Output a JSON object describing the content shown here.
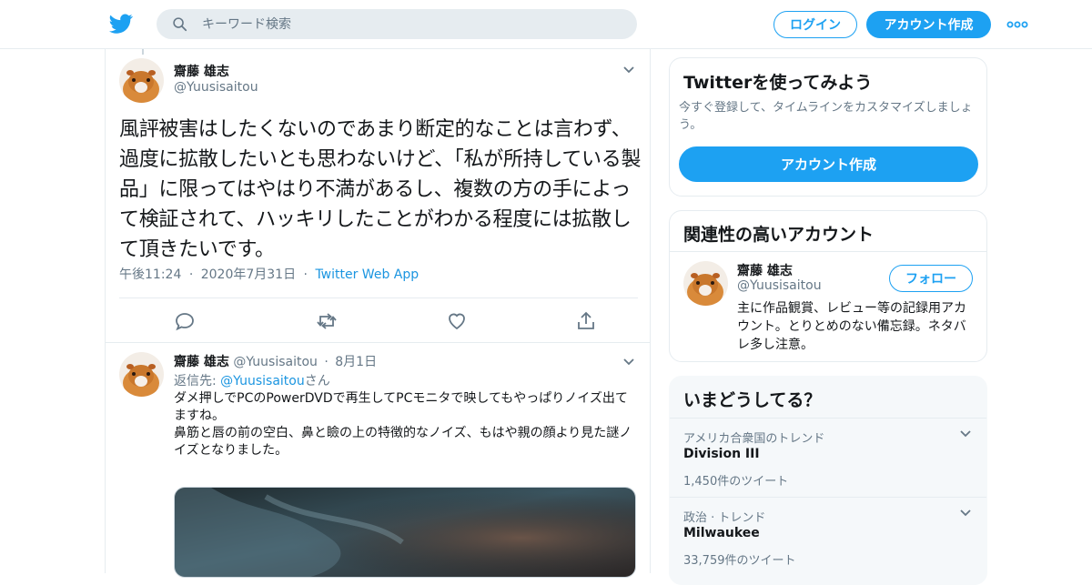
{
  "header": {
    "search_placeholder": "キーワード検索",
    "login_label": "ログイン",
    "signup_label": "アカウント作成"
  },
  "colors": {
    "accent": "#1da1f2",
    "link": "#1b95e0",
    "secondary_text": "#657786",
    "border": "#e6ecf0"
  },
  "icons": [
    "twitter-bird-icon",
    "search-icon",
    "more-dots-icon",
    "chevron-down-icon",
    "reply-icon",
    "retweet-icon",
    "like-icon",
    "share-icon"
  ],
  "focus_tweet": {
    "author_name": "齋藤 雄志",
    "author_handle": "@Yuusisaitou",
    "text": "風評被害はしたくないのであまり断定的なことは言わず、過度に拡散したいとも思わないけど、「私が所持している製品」に限ってはやはり不満があるし、複数の方の手によって検証されて、ハッキリしたことがわかる程度には拡散して頂きたいです。",
    "time": "午後11:24",
    "date": "2020年7月31日",
    "source": "Twitter Web App",
    "dot": "·"
  },
  "reply_tweet": {
    "author_name": "齋藤 雄志",
    "author_handle": "@Yuusisaitou",
    "date": "8月1日",
    "dot": "·",
    "reply_to_prefix": "返信先: ",
    "reply_to_handle": "@Yuusisaitou",
    "reply_to_suffix": "さん",
    "text": "ダメ押しでPCのPowerDVDで再生してPCモニタで映してもやっぱりノイズ出てますね。\n鼻筋と唇の前の空白、鼻と瞼の上の特徴的なノイズ、もはや親の顔より見た謎ノイズとなりました。"
  },
  "signup_card": {
    "title": "Twitterを使ってみよう",
    "description": "今すぐ登録して、タイムラインをカスタマイズしましょう。",
    "button_label": "アカウント作成"
  },
  "related_card": {
    "title": "関連性の高いアカウント",
    "account_name": "齋藤 雄志",
    "account_handle": "@Yuusisaitou",
    "follow_label": "フォロー",
    "bio": "主に作品観賞、レビュー等の記録用アカウント。とりとめのない備忘録。ネタバレ多し注意。"
  },
  "trends_card": {
    "title": "いまどうしてる？",
    "items": [
      {
        "context": "アメリカ合衆国のトレンド",
        "name": "Division III",
        "count": "1,450件のツイート"
      },
      {
        "context": "政治 · トレンド",
        "name": "Milwaukee",
        "count": "33,759件のツイート"
      }
    ]
  }
}
